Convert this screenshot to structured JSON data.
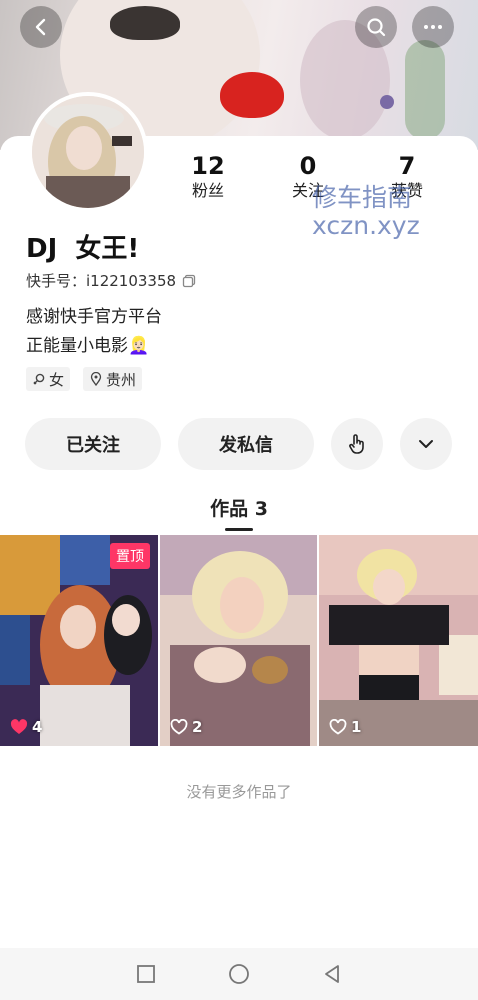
{
  "header": {
    "back": "back-arrow-icon",
    "search": "search-icon",
    "more": "more-icon"
  },
  "profile": {
    "name": "DJ  女王!",
    "kuaishou_id": "快手号：i122103358",
    "bio_lines": [
      "感谢快手官方平台",
      "正能量小电影👱🏻‍♀️"
    ],
    "tags": [
      {
        "icon": "female-icon",
        "text": "女"
      },
      {
        "icon": "location-icon",
        "text": "贵州"
      }
    ]
  },
  "stats": [
    {
      "value": "12",
      "label": "粉丝"
    },
    {
      "value": "0",
      "label": "关注"
    },
    {
      "value": "7",
      "label": "获赞"
    }
  ],
  "watermark": {
    "line1": "修车指南",
    "line2": "xczn.xyz"
  },
  "actions": {
    "following": "已关注",
    "message": "发私信",
    "poke": "hand-pointer-icon",
    "expand": "chevron-down-icon"
  },
  "works_tab": "作品 3",
  "videos": [
    {
      "likes": "4",
      "pinned": "置顶",
      "liked": true
    },
    {
      "likes": "2",
      "liked": false
    },
    {
      "likes": "1",
      "liked": false
    }
  ],
  "footer": {
    "no_more": "没有更多作品了"
  },
  "colors": {
    "accent": "#fe3666",
    "button_bg": "#f2f2f2"
  }
}
